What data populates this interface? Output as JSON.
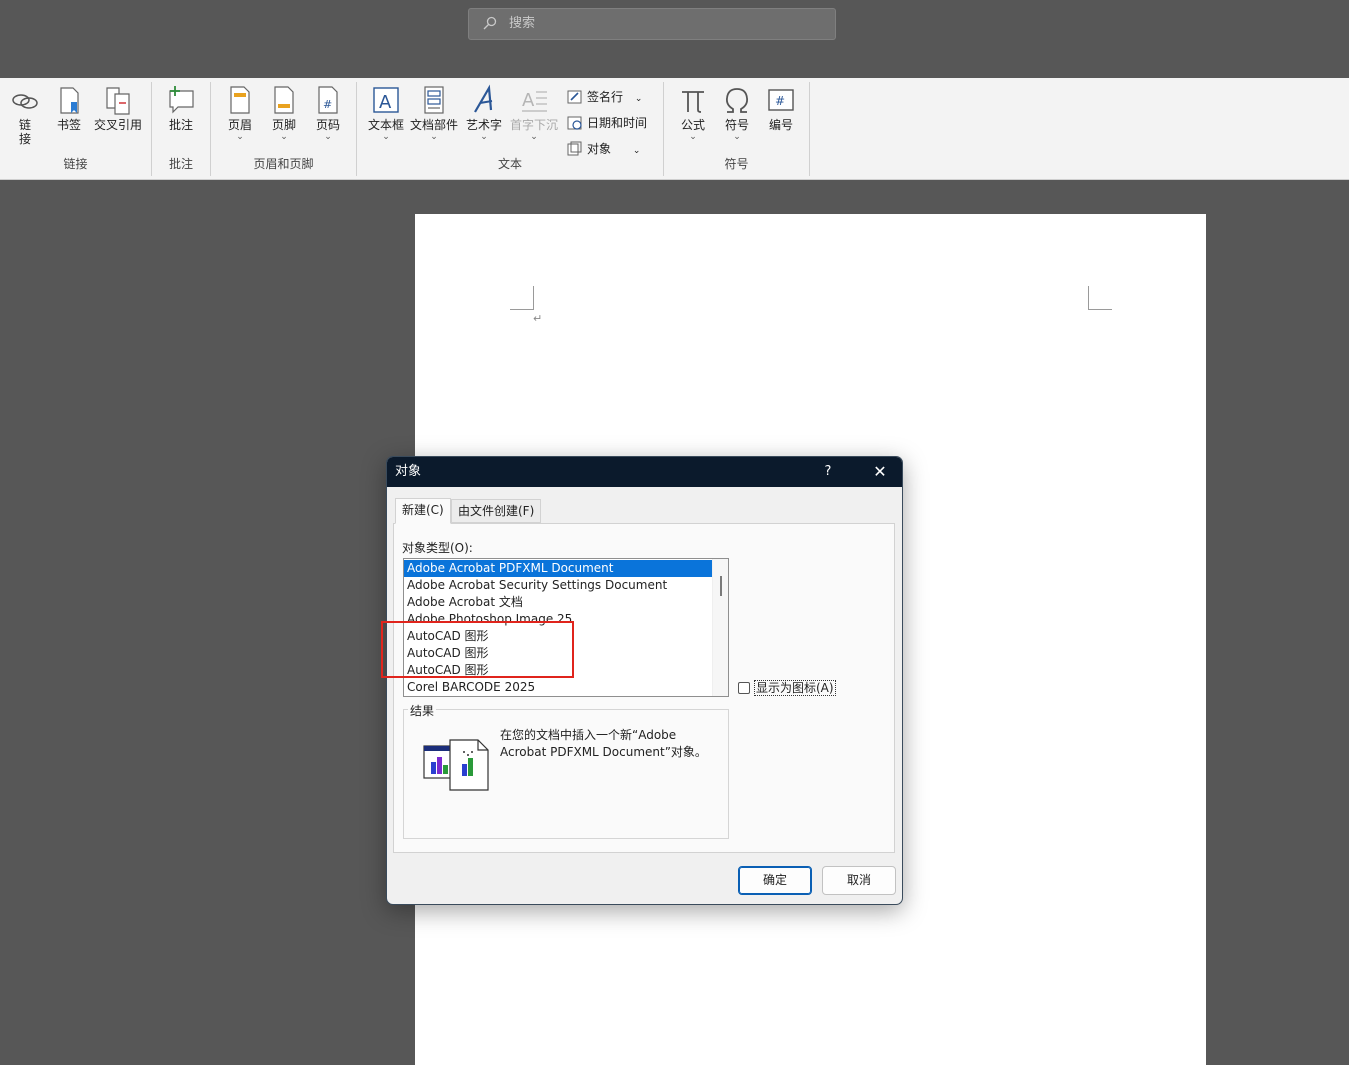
{
  "search": {
    "placeholder": "搜索",
    "icon": "search-icon"
  },
  "ribbon": {
    "groups": {
      "links": {
        "label": "链接",
        "buttons": [
          {
            "label": "链\n接",
            "icon": "link-icon"
          },
          {
            "label": "书签",
            "icon": "bookmark-icon"
          },
          {
            "label": "交叉引用",
            "icon": "cross-reference-icon"
          }
        ]
      },
      "comments": {
        "label": "批注",
        "buttons": [
          {
            "label": "批注",
            "icon": "comment-icon"
          }
        ]
      },
      "header_footer": {
        "label": "页眉和页脚",
        "buttons": [
          {
            "label": "页眉",
            "icon": "header-icon"
          },
          {
            "label": "页脚",
            "icon": "footer-icon"
          },
          {
            "label": "页码",
            "icon": "page-number-icon"
          }
        ]
      },
      "text": {
        "label": "文本",
        "buttons": [
          {
            "label": "文本框",
            "icon": "textbox-icon"
          },
          {
            "label": "文档部件",
            "icon": "quick-parts-icon"
          },
          {
            "label": "艺术字",
            "icon": "wordart-icon"
          },
          {
            "label": "首字下沉",
            "icon": "drop-cap-icon",
            "disabled": true
          }
        ],
        "small_buttons": [
          {
            "label": "签名行",
            "icon": "signature-line-icon"
          },
          {
            "label": "日期和时间",
            "icon": "date-time-icon"
          },
          {
            "label": "对象",
            "icon": "object-icon"
          }
        ]
      },
      "symbols": {
        "label": "符号",
        "buttons": [
          {
            "label": "公式",
            "icon": "equation-pi-icon"
          },
          {
            "label": "符号",
            "icon": "omega-symbol-icon"
          },
          {
            "label": "编号",
            "icon": "numbering-icon"
          }
        ]
      }
    }
  },
  "document": {
    "paragraph_mark": "↵"
  },
  "dialog": {
    "title": "对象",
    "help": "?",
    "close": "✕",
    "tabs": [
      {
        "label": "新建(C)",
        "active": true
      },
      {
        "label": "由文件创建(F)",
        "active": false
      }
    ],
    "object_type_label": "对象类型(O):",
    "object_types": [
      "Adobe Acrobat PDFXML Document",
      "Adobe Acrobat Security Settings Document",
      "Adobe Acrobat 文档",
      "Adobe Photoshop Image.25",
      "AutoCAD 图形",
      "AutoCAD 图形",
      "AutoCAD 图形",
      "Corel BARCODE 2025"
    ],
    "selected_index": 0,
    "display_as_icon": {
      "label": "显示为图标(A)",
      "checked": false
    },
    "result": {
      "legend": "结果",
      "text": "在您的文档中插入一个新“Adobe Acrobat PDFXML Document”对象。",
      "icon": "insert-object-chart-icon"
    },
    "ok": "确定",
    "cancel": "取消"
  },
  "colors": {
    "selection": "#0a74da",
    "annotation": "#e0241c",
    "dialog_titlebar": "#0b1a2c"
  }
}
